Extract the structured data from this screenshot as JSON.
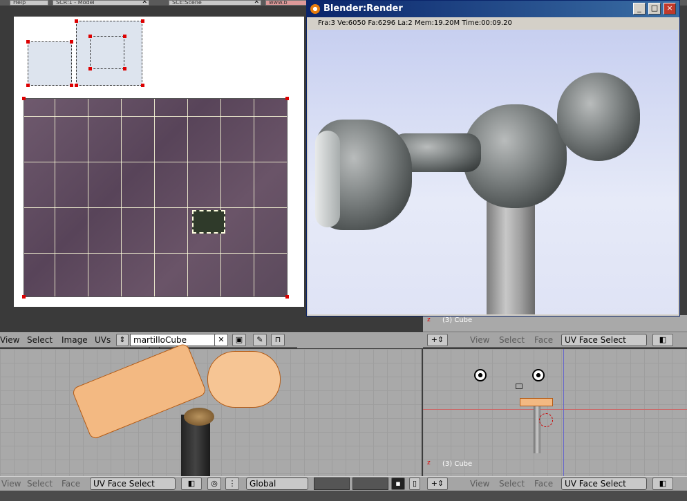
{
  "top_tabs": [
    "Help",
    "SCR:1 - Model",
    "SCE:Scene",
    "www.b"
  ],
  "image_editor": {
    "menus": [
      "View",
      "Select",
      "Image",
      "UVs"
    ],
    "image_name": "martilloCube copia.jp"
  },
  "render_window": {
    "title": "Blender:Render",
    "status": "Fra:3  Ve:6050 Fa:6296 La:2 Mem:19.20M Time:00:09.20",
    "controls": [
      "_",
      "□",
      "×"
    ]
  },
  "viewport_right_top": {
    "object_label": "(3) Cube",
    "menus": [
      "View",
      "Select",
      "Face"
    ],
    "mode": "UV Face Select"
  },
  "viewport_left": {
    "menus": [
      "View",
      "Select",
      "Face"
    ],
    "mode": "UV Face Select",
    "orientation": "Global"
  },
  "viewport_right_bottom": {
    "object_label": "(3) Cube",
    "menus": [
      "View",
      "Select",
      "Face"
    ],
    "mode": "UV Face Select"
  }
}
